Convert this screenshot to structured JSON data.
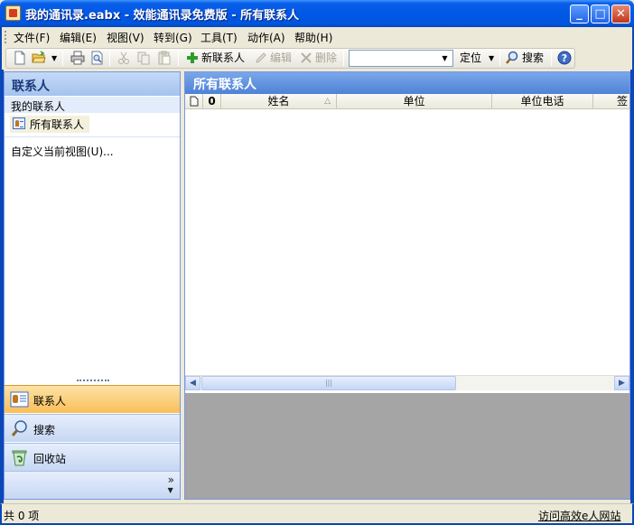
{
  "window": {
    "title": "我的通讯录.eabx - 效能通讯录免费版 - 所有联系人",
    "minimize": "_",
    "maximize": "□",
    "close": "✕"
  },
  "menu": [
    {
      "label": "文件(F)"
    },
    {
      "label": "编辑(E)"
    },
    {
      "label": "视图(V)"
    },
    {
      "label": "转到(G)"
    },
    {
      "label": "工具(T)"
    },
    {
      "label": "动作(A)"
    },
    {
      "label": "帮助(H)"
    }
  ],
  "toolbar": {
    "new_contact": "新联系人",
    "edit": "编辑",
    "delete": "删除",
    "search_value": "",
    "locate": "定位",
    "search": "搜索"
  },
  "left_pane": {
    "header": "联系人",
    "group_label": "我的联系人",
    "tree_item": "所有联系人",
    "custom_view": "自定义当前视图(U)..."
  },
  "nav": {
    "contacts": "联系人",
    "search": "搜索",
    "recycle": "回收站",
    "more": "»"
  },
  "right_pane": {
    "header": "所有联系人",
    "columns": {
      "name": "姓名",
      "company": "单位",
      "company_phone": "单位电话",
      "partial": "签"
    }
  },
  "status": {
    "count": "共 0 项",
    "link": "访问高效e人网站"
  }
}
